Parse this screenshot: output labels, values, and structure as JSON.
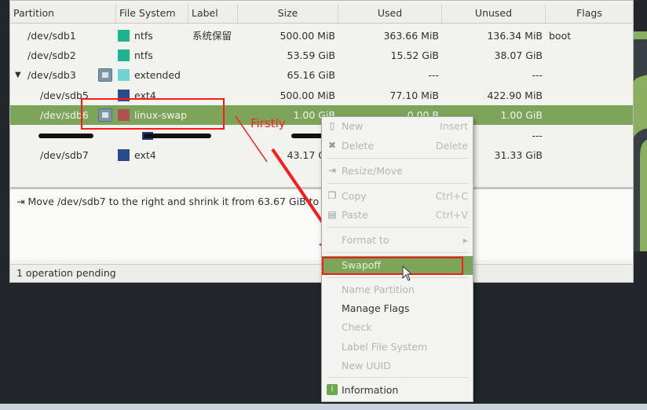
{
  "columns": [
    "Partition",
    "File System",
    "Label",
    "Size",
    "Used",
    "Unused",
    "Flags"
  ],
  "rows": [
    {
      "partition": "/dev/sdb1",
      "fs": "ntfs",
      "label": "系统保留",
      "size": "500.00 MiB",
      "used": "363.66 MiB",
      "unused": "136.34 MiB",
      "flags": "boot"
    },
    {
      "partition": "/dev/sdb2",
      "fs": "ntfs",
      "label": "",
      "size": "53.59 GiB",
      "used": "15.52 GiB",
      "unused": "38.07 GiB",
      "flags": ""
    },
    {
      "partition": "/dev/sdb3",
      "fs": "extended",
      "label": "",
      "size": "65.16 GiB",
      "used": "---",
      "unused": "---",
      "flags": ""
    },
    {
      "partition": "/dev/sdb5",
      "fs": "ext4",
      "label": "",
      "size": "500.00 MiB",
      "used": "77.10 MiB",
      "unused": "422.90 MiB",
      "flags": ""
    },
    {
      "partition": "/dev/sdb6",
      "fs": "linux-swap",
      "label": "",
      "size": "1.00 GiB",
      "used": "0.00 B",
      "unused": "1.00 GiB",
      "flags": ""
    },
    {
      "partition": "",
      "fs": "",
      "label": "",
      "size": "",
      "used": "",
      "unused": "---",
      "flags": ""
    },
    {
      "partition": "/dev/sdb7",
      "fs": "ext4",
      "label": "",
      "size": "43.17 GiB",
      "used": "",
      "unused": "31.33 GiB",
      "flags": ""
    }
  ],
  "fs_colors": {
    "ntfs": "#1cb38f",
    "extended": "#6fd3d3",
    "ext4": "#2a4a8a",
    "linux-swap": "#b0504f",
    "unknown": "#1e3b78"
  },
  "pending_operation": "Move /dev/sdb7 to the right and shrink it from 63.67 GiB to 43.17 G",
  "status": "1 operation pending",
  "annotation": "Firstly",
  "context_menu": {
    "items": [
      {
        "label": "New",
        "accel": "Insert"
      },
      {
        "label": "Delete",
        "accel": "Delete"
      },
      {
        "label": "Resize/Move",
        "accel": ""
      },
      {
        "label": "Copy",
        "accel": "Ctrl+C"
      },
      {
        "label": "Paste",
        "accel": "Ctrl+V"
      },
      {
        "label": "Format to",
        "accel": "▸"
      },
      {
        "label": "Swapoff",
        "accel": ""
      },
      {
        "label": "Name Partition",
        "accel": ""
      },
      {
        "label": "Manage Flags",
        "accel": ""
      },
      {
        "label": "Check",
        "accel": ""
      },
      {
        "label": "Label File System",
        "accel": ""
      },
      {
        "label": "New UUID",
        "accel": ""
      },
      {
        "label": "Information",
        "accel": ""
      }
    ]
  },
  "accent_color": "#7da55a",
  "annotation_color": "#ff1a1a"
}
